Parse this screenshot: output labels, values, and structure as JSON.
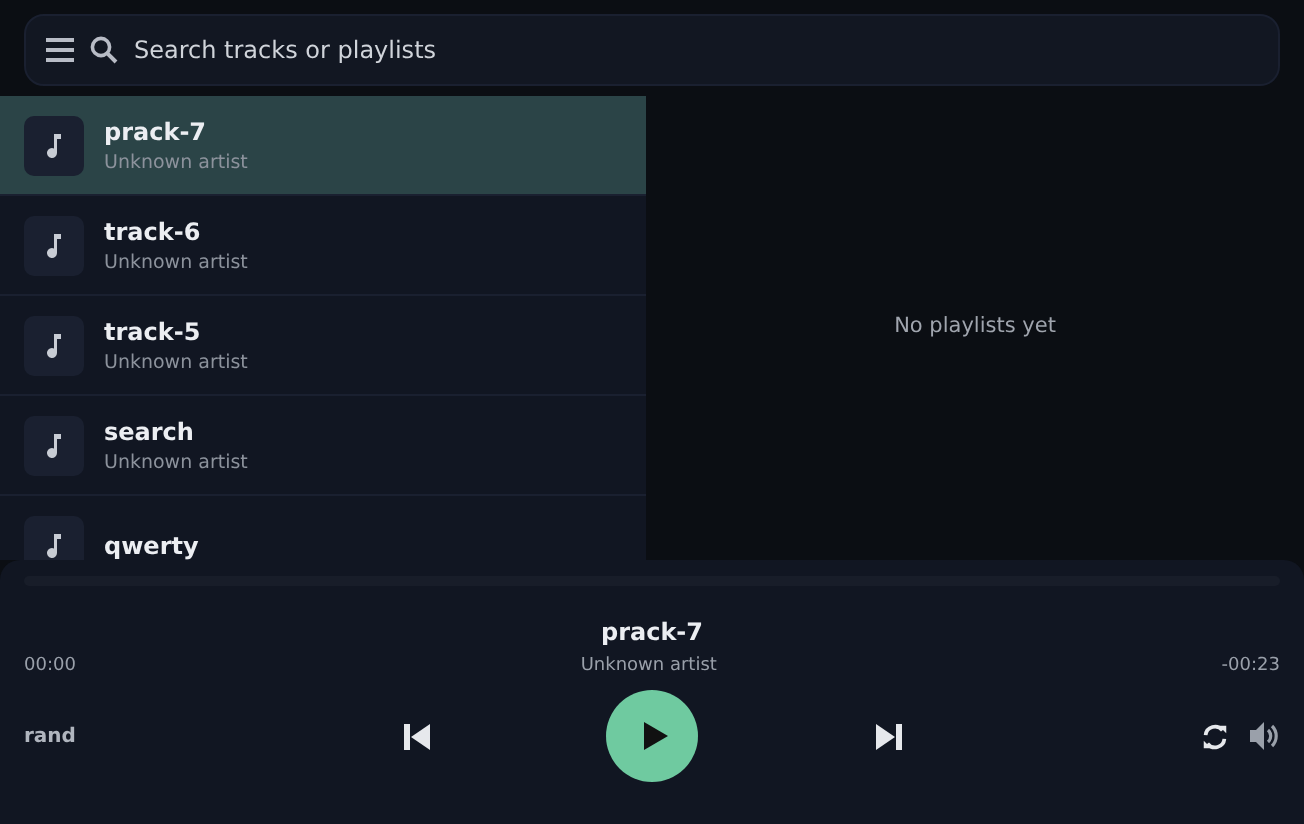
{
  "search": {
    "placeholder": "Search tracks or playlists"
  },
  "tracks": [
    {
      "title": "prack-7",
      "artist": "Unknown artist",
      "selected": true
    },
    {
      "title": "track-6",
      "artist": "Unknown artist",
      "selected": false
    },
    {
      "title": "track-5",
      "artist": "Unknown artist",
      "selected": false
    },
    {
      "title": "search",
      "artist": "Unknown artist",
      "selected": false
    },
    {
      "title": "qwerty",
      "selected": false
    }
  ],
  "playlists": {
    "empty_message": "No playlists yet"
  },
  "player": {
    "progress": {
      "level": 0
    },
    "title": "prack-7",
    "artist": "Unknown artist",
    "elapsed": "00:00",
    "remaining": "-00:23",
    "mode": "rand",
    "playing": false
  }
}
